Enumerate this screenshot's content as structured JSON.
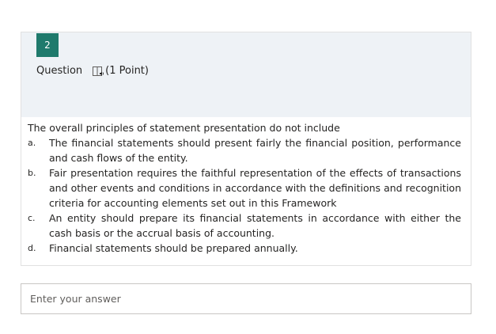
{
  "question": {
    "number": "2",
    "label": "Question",
    "points": "(1 Point)",
    "stem": "The overall principles of statement presentation do not include",
    "options": [
      {
        "letter": "a.",
        "text": "The financial statements should present fairly the financial position, performance and cash flows of the entity."
      },
      {
        "letter": "b.",
        "text": "Fair presentation requires the faithful representation of the effects of transactions and other events and conditions in accordance with the definitions and recognition criteria for accounting elements set out in this Framework"
      },
      {
        "letter": "c.",
        "text": "An entity should prepare its financial statements in accordance with either the cash basis or the accrual basis of accounting."
      },
      {
        "letter": "d.",
        "text": "Financial statements should be prepared annually."
      }
    ]
  },
  "answer": {
    "placeholder": "Enter your answer"
  },
  "colors": {
    "badge": "#1f7a6c",
    "header_bg": "#eef2f6"
  },
  "icons": {
    "read_aloud": "immersive-reader-icon"
  }
}
